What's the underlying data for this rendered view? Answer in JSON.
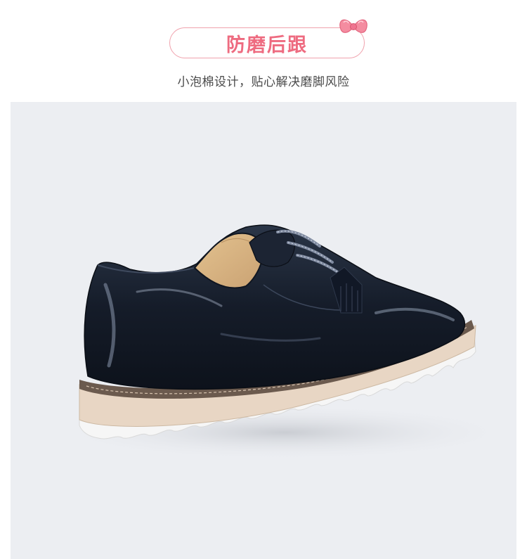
{
  "header": {
    "title": "防磨后跟",
    "subtitle": "小泡棉设计，贴心解决磨脚风险"
  },
  "colors": {
    "accent": "#ee6b80",
    "pill_border": "#f0a2ad",
    "photo_bg": "#eceef2",
    "shoe_leather": "#1a2230",
    "sole_cream": "#e9d7c6",
    "sole_white": "#f7f7f7"
  },
  "icons": {
    "bow": "bow-icon"
  },
  "image": {
    "subject": "shoe-photo"
  }
}
